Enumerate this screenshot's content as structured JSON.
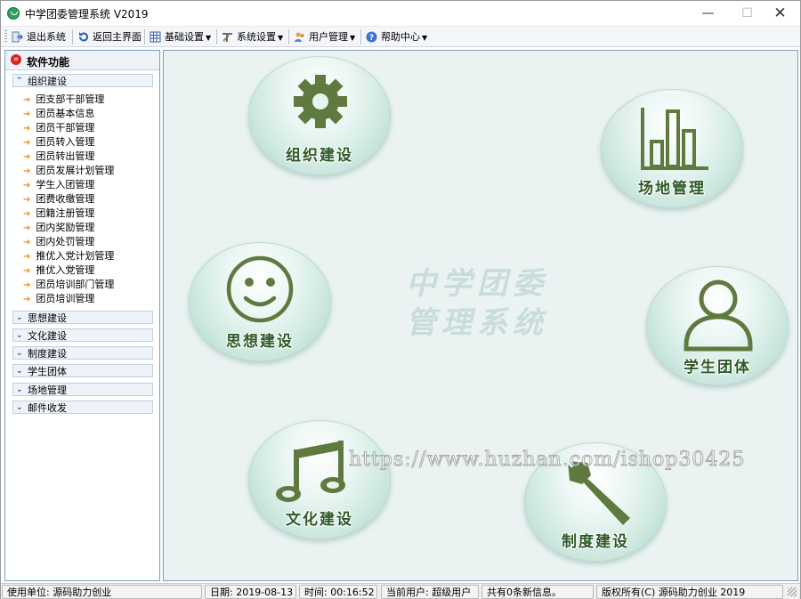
{
  "window": {
    "title": "中学团委管理系统 V2019",
    "minimize": "—",
    "maximize": "☐",
    "close": "✕"
  },
  "toolbar": {
    "exit": "退出系统",
    "home": "返回主界面",
    "basic": "基础设置",
    "system": "系统设置",
    "users": "用户管理",
    "help": "帮助中心"
  },
  "sidebar": {
    "header": "软件功能",
    "groups": [
      {
        "label": "组织建设",
        "items": [
          "团支部干部管理",
          "团员基本信息",
          "团员干部管理",
          "团员转入管理",
          "团员转出管理",
          "团员发展计划管理",
          "学生入团管理",
          "团费收缴管理",
          "团籍注册管理",
          "团内奖励管理",
          "团内处罚管理",
          "推优入党计划管理",
          "推优入党管理",
          "团员培训部门管理",
          "团员培训管理"
        ]
      },
      {
        "label": "思想建设"
      },
      {
        "label": "文化建设"
      },
      {
        "label": "制度建设"
      },
      {
        "label": "学生团体"
      },
      {
        "label": "场地管理"
      },
      {
        "label": "邮件收发"
      }
    ]
  },
  "main": {
    "buttons": {
      "org": "组织建设",
      "venue": "场地管理",
      "thought": "思想建设",
      "student": "学生团体",
      "culture": "文化建设",
      "system": "制度建设"
    },
    "watermark_line1": "中学团委",
    "watermark_line2": "管理系统",
    "url_watermark": "https://www.huzhan.com/ishop30425"
  },
  "status": {
    "unit": "使用单位: 源码助力创业",
    "date": "日期: 2019-08-13",
    "time": "时间: 00:16:52",
    "user": "当前用户: 超级用户",
    "messages": "共有0条新信息。",
    "copyright": "版权所有(C) 源码助力创业 2019"
  },
  "colors": {
    "icon_green": "#5e7a3f",
    "label_green": "#2d5a28",
    "accent_orange": "#f09020"
  }
}
